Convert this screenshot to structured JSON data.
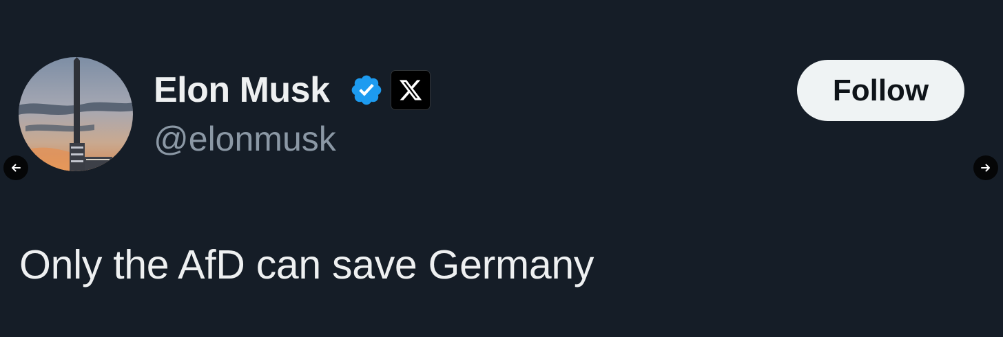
{
  "tweet": {
    "author": {
      "display_name": "Elon Musk",
      "handle": "@elonmusk",
      "avatar_icon": "rocket-launch-avatar",
      "verified_icon": "verified-badge-icon",
      "affiliate_icon": "x-logo-icon"
    },
    "follow_label": "Follow",
    "text": "Only the AfD can save Germany"
  },
  "carousel": {
    "prev_icon": "arrow-left-icon",
    "next_icon": "arrow-right-icon"
  },
  "colors": {
    "background": "#151d27",
    "primary_text": "#eef0f1",
    "secondary_text": "#8b98a5",
    "verified_blue": "#1d9bf0",
    "follow_button_bg": "#eff3f4"
  }
}
